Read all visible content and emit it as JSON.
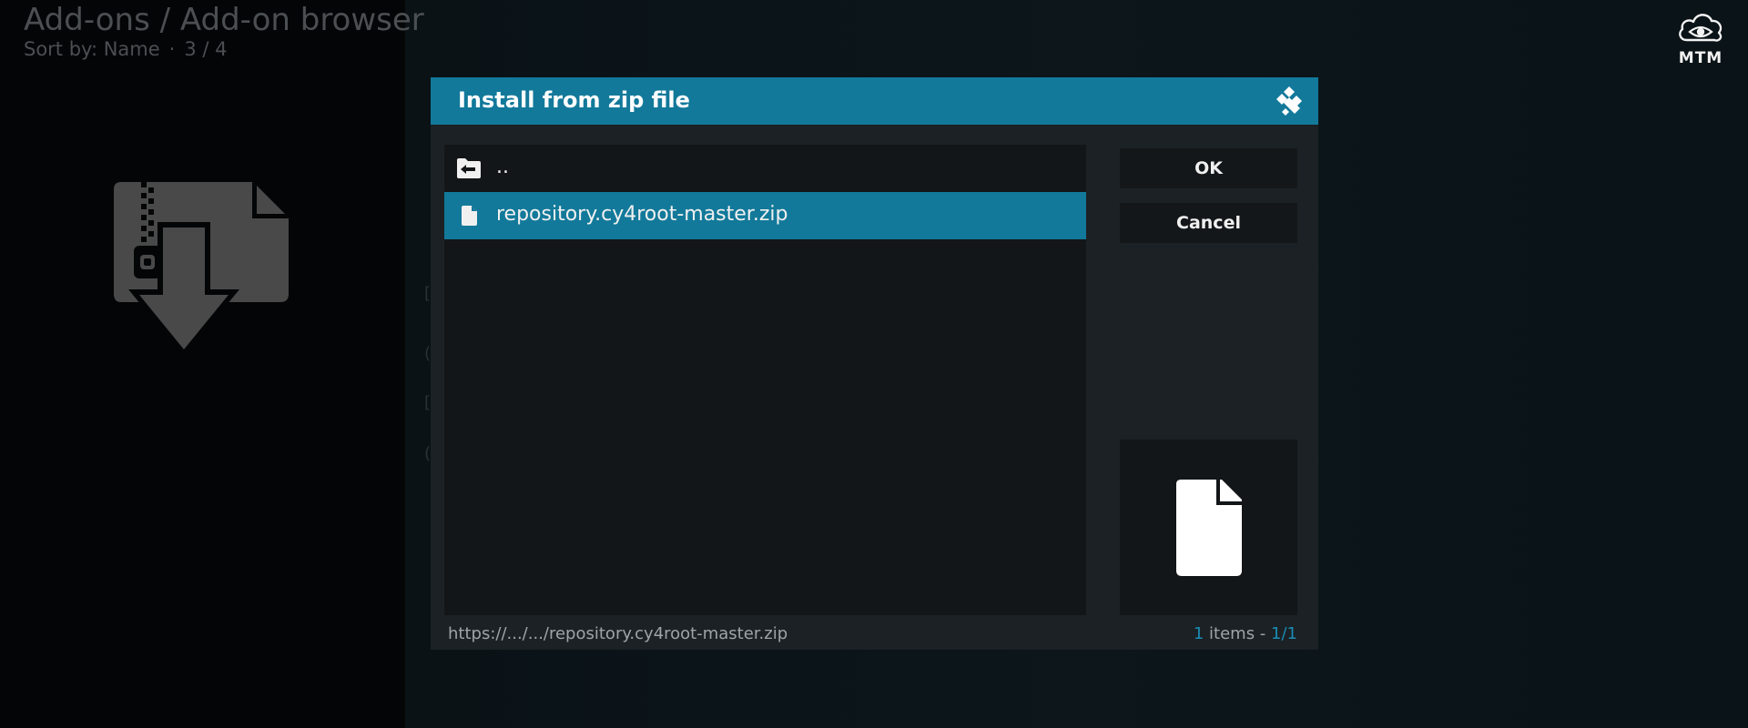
{
  "header": {
    "title": "Add-ons / Add-on browser",
    "sort_label": "Sort by: Name",
    "separator": "·",
    "position": "3 / 4"
  },
  "logo": {
    "text": "MTM",
    "icon": "cloud-eye-icon"
  },
  "background_art": {
    "icon": "zip-install-icon"
  },
  "dialog": {
    "title": "Install from zip file",
    "brand_icon": "kodi-icon",
    "file_list": [
      {
        "label": "..",
        "icon": "folder-up-icon",
        "selected": false
      },
      {
        "label": "repository.cy4root-master.zip",
        "icon": "file-icon",
        "selected": true
      }
    ],
    "buttons": {
      "ok": "OK",
      "cancel": "Cancel"
    },
    "preview_icon": "file-icon",
    "footer": {
      "path": "https://.../.../repository.cy4root-master.zip",
      "items_count": "1",
      "items_word": "items -",
      "page": "1/1"
    }
  },
  "colors": {
    "accent": "#12799a",
    "dialog_bg": "#1b2124",
    "list_bg": "#131618",
    "highlight_text": "#1b8bb5"
  }
}
